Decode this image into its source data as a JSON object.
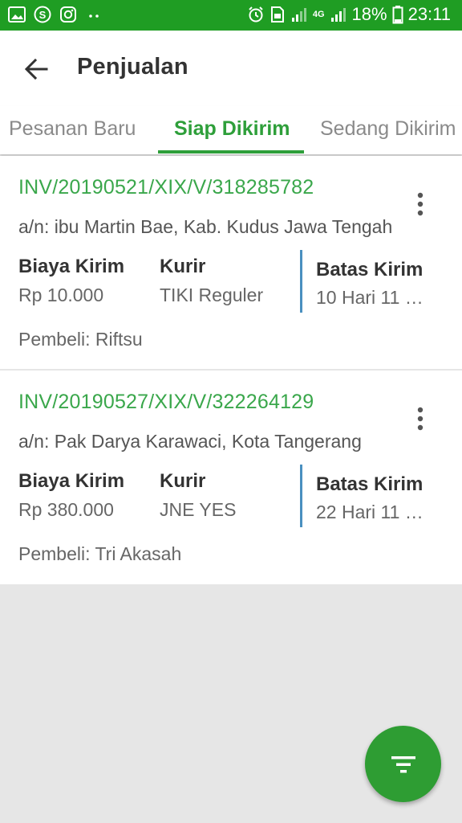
{
  "status_bar": {
    "battery": "18%",
    "time": "23:11",
    "network": "4G",
    "icons_left": [
      "gallery-icon",
      "shopee-icon",
      "instagram-icon",
      "more-dots-icon"
    ],
    "icons_right": [
      "alarm-icon",
      "sim-icon",
      "signal-icon",
      "signal-icon",
      "battery-icon"
    ]
  },
  "appbar": {
    "title": "Penjualan"
  },
  "tabs": [
    {
      "label": "Pesanan Baru",
      "active": false
    },
    {
      "label": "Siap Dikirim",
      "active": true
    },
    {
      "label": "Sedang Dikirim",
      "active": false
    }
  ],
  "labels": {
    "biaya_kirim": "Biaya Kirim",
    "kurir": "Kurir",
    "batas_kirim": "Batas Kirim"
  },
  "orders": [
    {
      "invoice": "INV/20190521/XIX/V/318285782",
      "address": "a/n: ibu Martin Bae, Kab. Kudus Jawa Tengah",
      "biaya_kirim": "Rp 10.000",
      "kurir": "TIKI Reguler",
      "batas_kirim": "10 Hari 11 …",
      "pembeli": "Pembeli: Riftsu"
    },
    {
      "invoice": "INV/20190527/XIX/V/322264129",
      "address": "a/n: Pak Darya Karawaci, Kota Tangerang",
      "biaya_kirim": "Rp 380.000",
      "kurir": "JNE YES",
      "batas_kirim": "22 Hari 11 …",
      "pembeli": "Pembeli: Tri Akasah"
    }
  ],
  "colors": {
    "status_bar": "#1f9d23",
    "accent": "#2e9f3a",
    "divider": "#4a90c0",
    "fab": "#2e9d33"
  }
}
